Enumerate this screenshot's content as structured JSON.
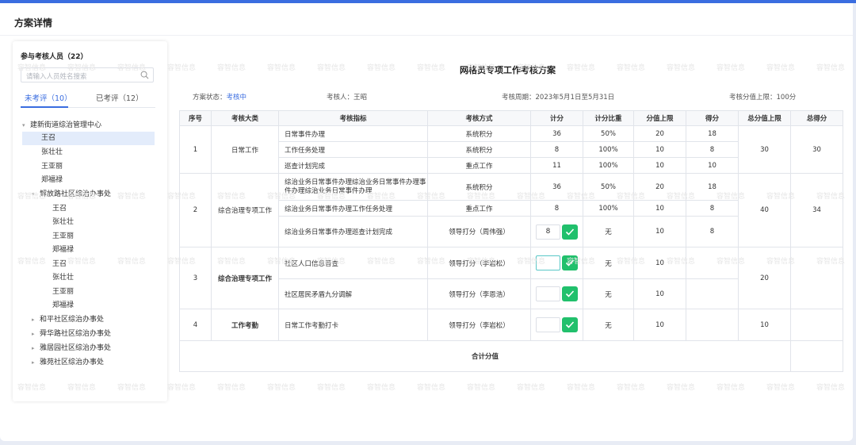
{
  "page": {
    "title": "方案详情"
  },
  "left": {
    "title": "参与考核人员（22）",
    "search_placeholder": "请输入人员姓名搜索",
    "tabs": [
      {
        "label": "未考评（10）"
      },
      {
        "label": "已考评（12）"
      }
    ],
    "tree": {
      "group1": "建新街道综治管理中心",
      "group1_people": [
        "王召",
        "张壮壮",
        "王亚丽",
        "郑福禄"
      ],
      "group2": "解放路社区综治办事处",
      "group2_people": [
        "王召",
        "张壮壮",
        "王亚丽",
        "郑福禄",
        "王召",
        "张壮壮",
        "王亚丽",
        "郑福禄"
      ],
      "collapsed": [
        "和平社区综治办事处",
        "舜华路社区综治办事处",
        "雅居园社区综治办事处",
        "雅苑社区综治办事处"
      ]
    }
  },
  "sheet": {
    "title": "网格员专项工作考核方案",
    "status_label": "方案状态：",
    "status_value": "考核中",
    "assessor": "考核人：王昭",
    "period": "考核周期：2023年5月1日至5月31日",
    "cap": "考核分值上限：100分",
    "headers": [
      "序号",
      "考核大类",
      "考核指标",
      "考核方式",
      "计分",
      "计分比重",
      "分值上限",
      "得分",
      "总分值上限",
      "总得分"
    ],
    "groups": [
      {
        "no": "1",
        "category": "日常工作",
        "cap": "30",
        "total": "30",
        "rows": [
          {
            "indicator": "日常事件办理",
            "method": "系统积分",
            "points": "36",
            "weight": "50%",
            "limit": "20",
            "score": "18"
          },
          {
            "indicator": "工作任务处理",
            "method": "系统积分",
            "points": "8",
            "weight": "100%",
            "limit": "10",
            "score": "8"
          },
          {
            "indicator": "巡查计划完成",
            "method": "重点工作",
            "points": "11",
            "weight": "100%",
            "limit": "10",
            "score": "10"
          }
        ]
      },
      {
        "no": "2",
        "category": "综合治理专项工作",
        "cap": "40",
        "total": "34",
        "rows": [
          {
            "indicator": "综治业务日常事件办理综治业务日常事件办理事件办理综治业务日常事件办理",
            "method": "系统积分",
            "points": "36",
            "weight": "50%",
            "limit": "20",
            "score": "18"
          },
          {
            "indicator": "综治业务日常事件办理工作任务处理",
            "method": "重点工作",
            "points": "8",
            "weight": "100%",
            "limit": "10",
            "score": "8"
          },
          {
            "indicator": "综治业务日常事件办理巡查计划完成",
            "method": "领导打分（周伟强）",
            "points": "8",
            "weight": "无",
            "limit": "10",
            "score": "8"
          }
        ]
      },
      {
        "no": "3",
        "category": "综合治理专项工作",
        "cap": "20",
        "total": "",
        "rows": [
          {
            "indicator": "社区人口信息普查",
            "method": "领导打分（李岩松）",
            "points": "",
            "weight": "无",
            "limit": "10",
            "score": ""
          },
          {
            "indicator": "社区居民矛盾九分调解",
            "method": "领导打分（李恩浩）",
            "points": "",
            "weight": "无",
            "limit": "10",
            "score": ""
          }
        ]
      },
      {
        "no": "4",
        "category": "工作考勤",
        "cap": "10",
        "total": "",
        "rows": [
          {
            "indicator": "日常工作考勤打卡",
            "method": "领导打分（李岩松）",
            "points": "",
            "weight": "无",
            "limit": "10",
            "score": ""
          }
        ]
      }
    ],
    "footer": "合计分值"
  },
  "watermark": "容智信息",
  "colors": {
    "accent": "#3a6de0",
    "confirm": "#21c06c",
    "score": "#e0a040"
  }
}
